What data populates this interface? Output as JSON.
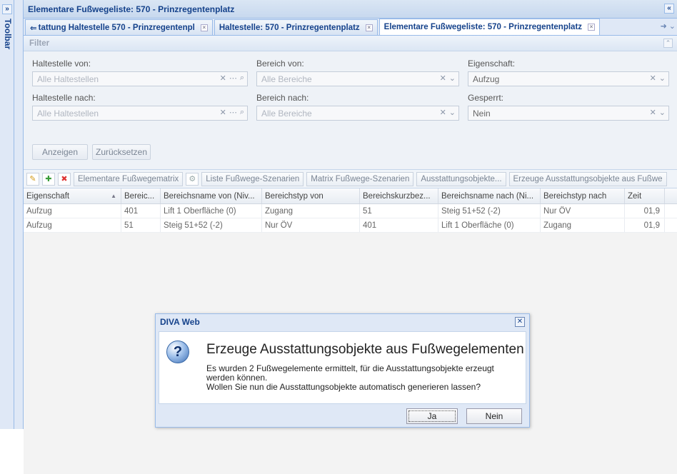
{
  "toolbar": {
    "label": "Toolbar",
    "expand_glyph": "»"
  },
  "panel": {
    "title": "Elementare Fußwegeliste: 570 - Prinzregentenplatz",
    "collapse_glyph": "«"
  },
  "tabs": [
    {
      "label": "tattung Haltestelle 570 - Prinzregentenpl",
      "active": false
    },
    {
      "label": "Haltestelle: 570 - Prinzregentenplatz",
      "active": false
    },
    {
      "label": "Elementare Fußwegeliste: 570 - Prinzregentenplatz",
      "active": true
    }
  ],
  "filter": {
    "title": "Filter",
    "haltestelle_von": {
      "label": "Haltestelle von:",
      "placeholder": "Alle Haltestellen"
    },
    "haltestelle_nach": {
      "label": "Haltestelle nach:",
      "placeholder": "Alle Haltestellen"
    },
    "bereich_von": {
      "label": "Bereich von:",
      "placeholder": "Alle Bereiche"
    },
    "bereich_nach": {
      "label": "Bereich nach:",
      "placeholder": "Alle Bereiche"
    },
    "eigenschaft": {
      "label": "Eigenschaft:",
      "value": "Aufzug"
    },
    "gesperrt": {
      "label": "Gesperrt:",
      "value": "Nein"
    },
    "show_label": "Anzeigen",
    "reset_label": "Zurücksetzen"
  },
  "grid_toolbar": {
    "elementare_label": "Elementare Fußwegematrix",
    "liste_label": "Liste Fußwege-Szenarien",
    "matrix_label": "Matrix Fußwege-Szenarien",
    "ausstattung_label": "Ausstattungsobjekte...",
    "erzeuge_label": "Erzeuge Ausstattungsobjekte aus Fußwe"
  },
  "grid": {
    "columns": [
      "Eigenschaft",
      "Bereic...",
      "Bereichsname von (Niv...",
      "Bereichstyp von",
      "Bereichskurzbez...",
      "Bereichsname nach (Ni...",
      "Bereichstyp nach",
      "Zeit"
    ],
    "rows": [
      [
        "Aufzug",
        "401",
        "Lift 1 Oberfläche (0)",
        "Zugang",
        "51",
        "Steig 51+52 (-2)",
        "Nur ÖV",
        "01,9"
      ],
      [
        "Aufzug",
        "51",
        "Steig 51+52 (-2)",
        "Nur ÖV",
        "401",
        "Lift 1 Oberfläche (0)",
        "Zugang",
        "01,9"
      ]
    ]
  },
  "dialog": {
    "title": "DIVA Web",
    "heading": "Erzeuge Ausstattungsobjekte aus Fußwegelementen",
    "message_line1": "Es wurden 2 Fußwegelemente ermittelt, für die Ausstattungsobjekte erzeugt werden können.",
    "message_line2": "Wollen Sie nun die Ausstattungsobjekte automatisch generieren lassen?",
    "yes_label": "Ja",
    "no_label": "Nein"
  }
}
